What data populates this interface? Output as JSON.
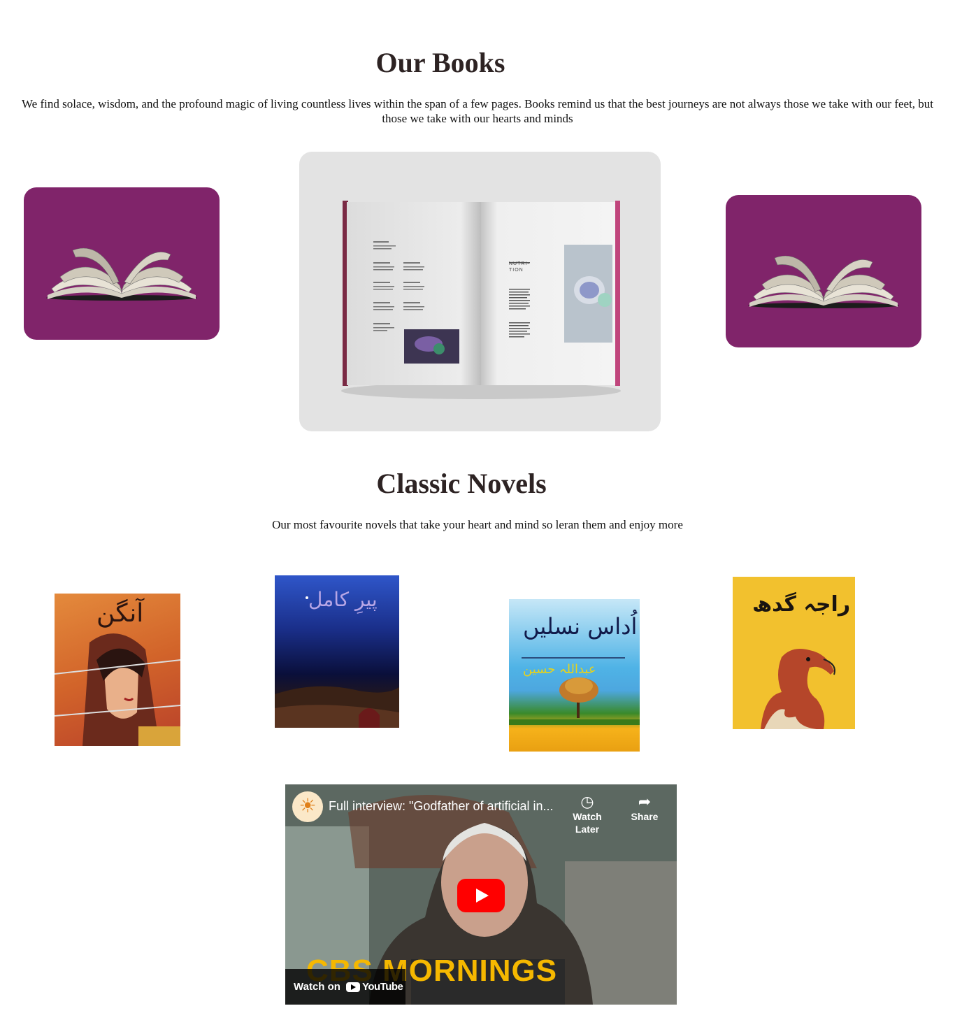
{
  "our_books": {
    "title": "Our Books",
    "description": "We find solace, wisdom, and the profound magic of living countless lives within the span of a few pages. Books remind us that the best journeys are not always those we take with our feet, but those we take with our hearts and minds"
  },
  "book_mockup": {
    "heading": "NUTRI-\nTION"
  },
  "classic_novels": {
    "title": "Classic Novels",
    "description": "Our most favourite novels that take your heart and mind so leran them and enjoy more",
    "covers": [
      {
        "title": "آنگن"
      },
      {
        "title": "پیرِ کامل"
      },
      {
        "title": "اُداس نسلیں",
        "author": "عبداللہ حسین"
      },
      {
        "title": "راجہ گدھ"
      }
    ]
  },
  "video": {
    "title": "Full interview: \"Godfather of artificial in...",
    "watch_later": "Watch Later",
    "share": "Share",
    "watch_on": "Watch on",
    "youtube": "YouTube",
    "brand": "CBS MORNINGS"
  },
  "colors": {
    "card_purple": "#80246a",
    "title_color": "#2d2323",
    "youtube_red": "#ff0000",
    "cbs_yellow": "#f5b800"
  }
}
